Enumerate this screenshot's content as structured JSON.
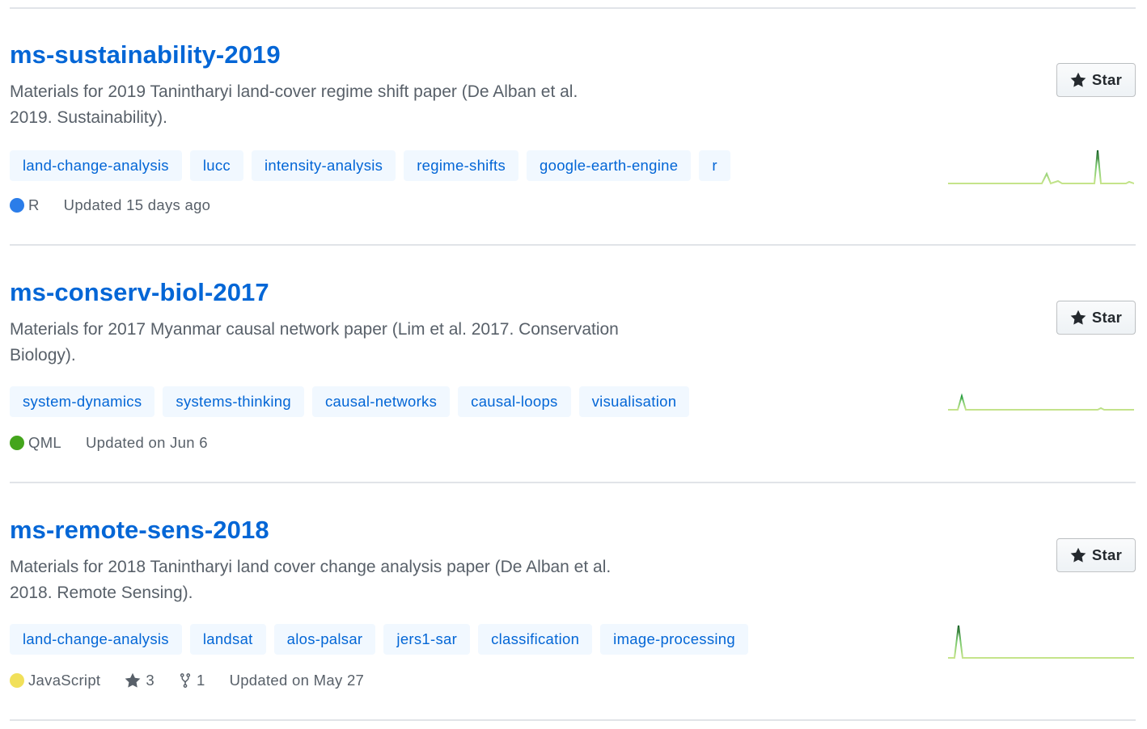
{
  "repos": [
    {
      "name": "ms-sustainability-2019",
      "description": "Materials for 2019 Tanintharyi land-cover regime shift paper (De Alban et al. 2019. Sustainability).",
      "topics": [
        "land-change-analysis",
        "lucc",
        "intensity-analysis",
        "regime-shifts",
        "google-earth-engine",
        "r"
      ],
      "language": "R",
      "language_color": "#2b7de9",
      "stars": null,
      "forks": null,
      "updated": "Updated 15 days ago",
      "star_button": "Star"
    },
    {
      "name": "ms-conserv-biol-2017",
      "description": "Materials for 2017 Myanmar causal network paper (Lim et al. 2017. Conservation Biology).",
      "topics": [
        "system-dynamics",
        "systems-thinking",
        "causal-networks",
        "causal-loops",
        "visualisation"
      ],
      "language": "QML",
      "language_color": "#44a51c",
      "stars": null,
      "forks": null,
      "updated": "Updated on Jun 6",
      "star_button": "Star"
    },
    {
      "name": "ms-remote-sens-2018",
      "description": "Materials for 2018 Tanintharyi land cover change analysis paper (De Alban et al. 2018. Remote Sensing).",
      "topics": [
        "land-change-analysis",
        "landsat",
        "alos-palsar",
        "jers1-sar",
        "classification",
        "image-processing"
      ],
      "language": "JavaScript",
      "language_color": "#f1e05a",
      "stars": "3",
      "forks": "1",
      "updated": "Updated on May 27",
      "star_button": "Star"
    }
  ],
  "icons": {
    "star": "star-icon",
    "fork": "repo-forked-icon"
  },
  "colors": {
    "link": "#0366d6",
    "topic_bg": "#f1f8ff",
    "sparkline": "#2ea44f"
  }
}
